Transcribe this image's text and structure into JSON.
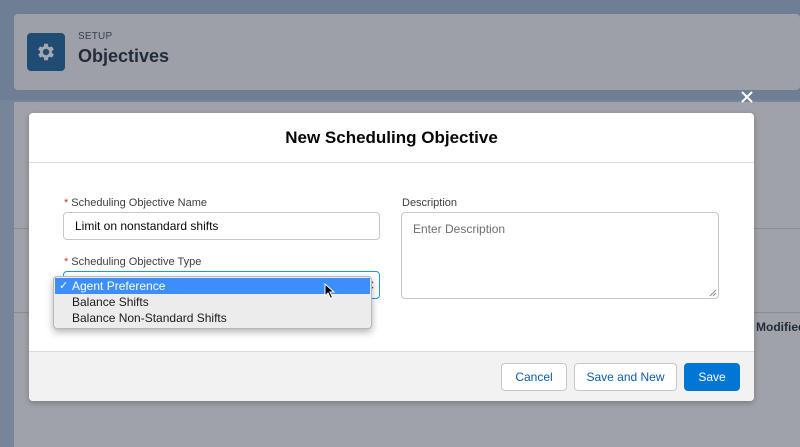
{
  "background": {
    "eyebrow": "SETUP",
    "page_title": "Objectives",
    "column_header": "Modified"
  },
  "modal": {
    "title": "New Scheduling Objective",
    "close_icon": "close-icon",
    "name_field": {
      "label": "Scheduling Objective Name",
      "value": "Limit on nonstandard shifts",
      "required_marker": "*"
    },
    "type_field": {
      "label": "Scheduling Objective Type",
      "required_marker": "*",
      "options": [
        "Agent Preference",
        "Balance Shifts",
        "Balance Non-Standard Shifts"
      ],
      "selected_index": 0,
      "check_mark": "✓"
    },
    "description_field": {
      "label": "Description",
      "placeholder": "Enter Description"
    },
    "footer": {
      "cancel_label": "Cancel",
      "save_new_label": "Save and New",
      "save_label": "Save"
    }
  },
  "colors": {
    "brand": "#0176d3",
    "selected_option": "#3d8ef8",
    "required": "#c23934",
    "header_icon": "#1b5f99"
  }
}
